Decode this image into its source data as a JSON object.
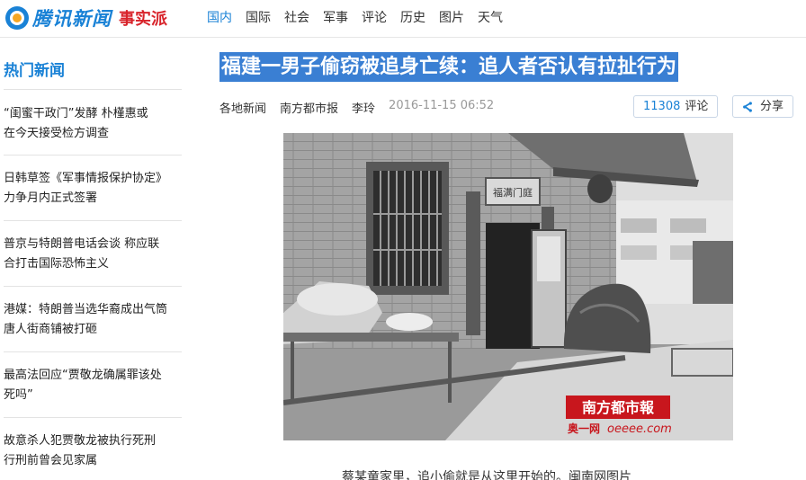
{
  "header": {
    "logo_text": "腾讯新闻",
    "logo_sub": "事实派",
    "nav": [
      {
        "label": "国内",
        "active": true
      },
      {
        "label": "国际"
      },
      {
        "label": "社会"
      },
      {
        "label": "军事"
      },
      {
        "label": "评论"
      },
      {
        "label": "历史"
      },
      {
        "label": "图片"
      },
      {
        "label": "天气"
      }
    ]
  },
  "sidebar": {
    "title": "热门新闻",
    "items": [
      {
        "line1": "“闺蜜干政门”发酵 朴槿惠或",
        "line2": "在今天接受检方调查"
      },
      {
        "line1": "日韩草签《军事情报保护协定》",
        "line2": "力争月内正式签署"
      },
      {
        "line1": "普京与特朗普电话会谈 称应联",
        "line2": "合打击国际恐怖主义"
      },
      {
        "line1": "港媒：特朗普当选华裔成出气筒",
        "line2": "唐人街商铺被打砸"
      },
      {
        "line1": "最高法回应“贾敬龙确属罪该处",
        "line2": "死吗”"
      },
      {
        "line1": "故意杀人犯贾敬龙被执行死刑",
        "line2": "行刑前曾会见家属"
      }
    ]
  },
  "article": {
    "headline": "福建一男子偷窃被追身亡续：追人者否认有拉扯行为",
    "source": "各地新闻",
    "media": "南方都市报",
    "author": "李玲",
    "date": "2016-11-15 06:52",
    "comment_count": "11308",
    "comment_label": "评论",
    "share_label": "分享",
    "photo": {
      "plaque": "福满门庭",
      "watermark_title": "南方都市報",
      "watermark_sub": "奥一网",
      "watermark_url": "oeeee.com"
    },
    "caption": "蔡某童家里，追小偷就是从这里开始的。闽南网图片"
  }
}
